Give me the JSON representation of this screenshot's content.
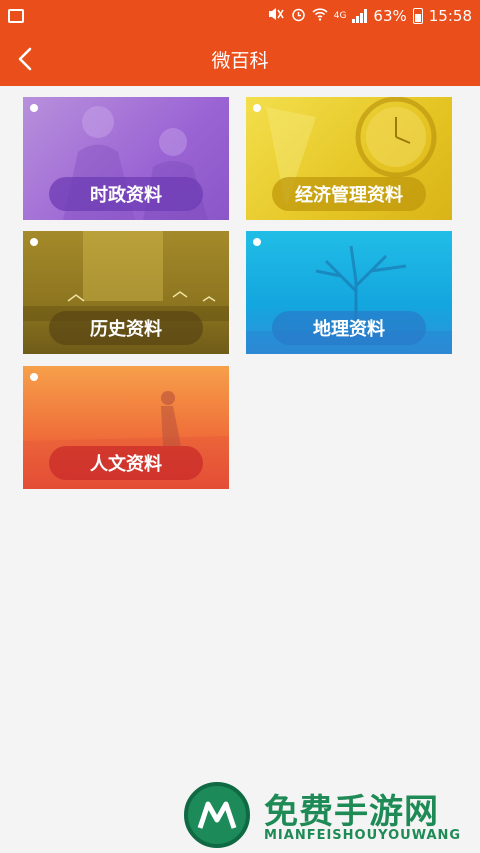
{
  "status_bar": {
    "network": "4G",
    "battery": "63%",
    "time": "15:58"
  },
  "header": {
    "title": "微百科"
  },
  "categories": [
    {
      "label": "时政资料",
      "color": "#9b64d4"
    },
    {
      "label": "经济管理资料",
      "color": "#e5c524"
    },
    {
      "label": "历史资料",
      "color": "#8d7520"
    },
    {
      "label": "地理资料",
      "color": "#14a6df"
    },
    {
      "label": "人文资料",
      "color": "#f0703a"
    }
  ],
  "watermark": {
    "title": "免费手游网",
    "subtitle": "MIANFEISHOUYOUWANG"
  },
  "colors": {
    "accent": "#ea4e1b",
    "background": "#f4f4f4"
  }
}
